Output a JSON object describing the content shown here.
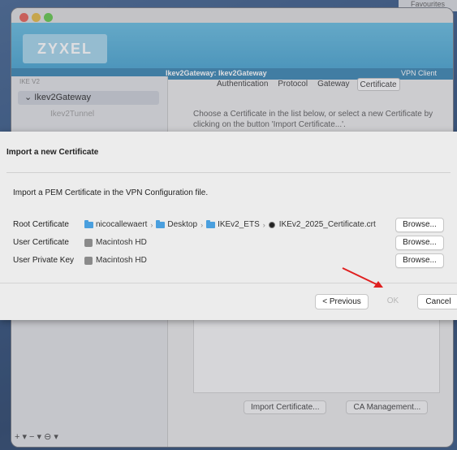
{
  "desktop": {
    "favourites_label": "Favourites"
  },
  "app": {
    "logo": "ZYXEL",
    "banner_left": "Ikev2Gateway: Ikev2Gateway",
    "banner_right": "VPN Client",
    "sidebar": {
      "section_label": "IKE V2",
      "gateway_item": "Ikev2Gateway",
      "tunnel_item": "Ikev2Tunnel",
      "footer_controls": "+ ▾  − ▾  ⊖ ▾"
    },
    "tabs": [
      "Authentication",
      "Protocol",
      "Gateway",
      "Certificate"
    ],
    "active_tab": "Certificate",
    "description": "Choose a Certificate in the list below, or select a new Certificate by clicking on the button 'Import Certificate...'.",
    "buttons": {
      "import_certificate": "Import Certificate...",
      "ca_management": "CA Management..."
    }
  },
  "dialog": {
    "title": "Import a new Certificate",
    "instruction": "Import a PEM Certificate in the VPN Configuration file.",
    "rows": {
      "root": {
        "label": "Root Certificate",
        "path": [
          "nicocallewaert",
          "Desktop",
          "IKEv2_ETS",
          "IKEv2_2025_Certificate.crt"
        ]
      },
      "user": {
        "label": "User Certificate",
        "path_value": "Macintosh HD"
      },
      "private_key": {
        "label": "User Private Key",
        "path_value": "Macintosh HD"
      }
    },
    "browse_label": "Browse...",
    "previous_label": "< Previous",
    "ok_label": "OK",
    "cancel_label": "Cancel"
  },
  "colors": {
    "accent": "#3a9ccc",
    "annotation_arrow": "#e02020"
  }
}
